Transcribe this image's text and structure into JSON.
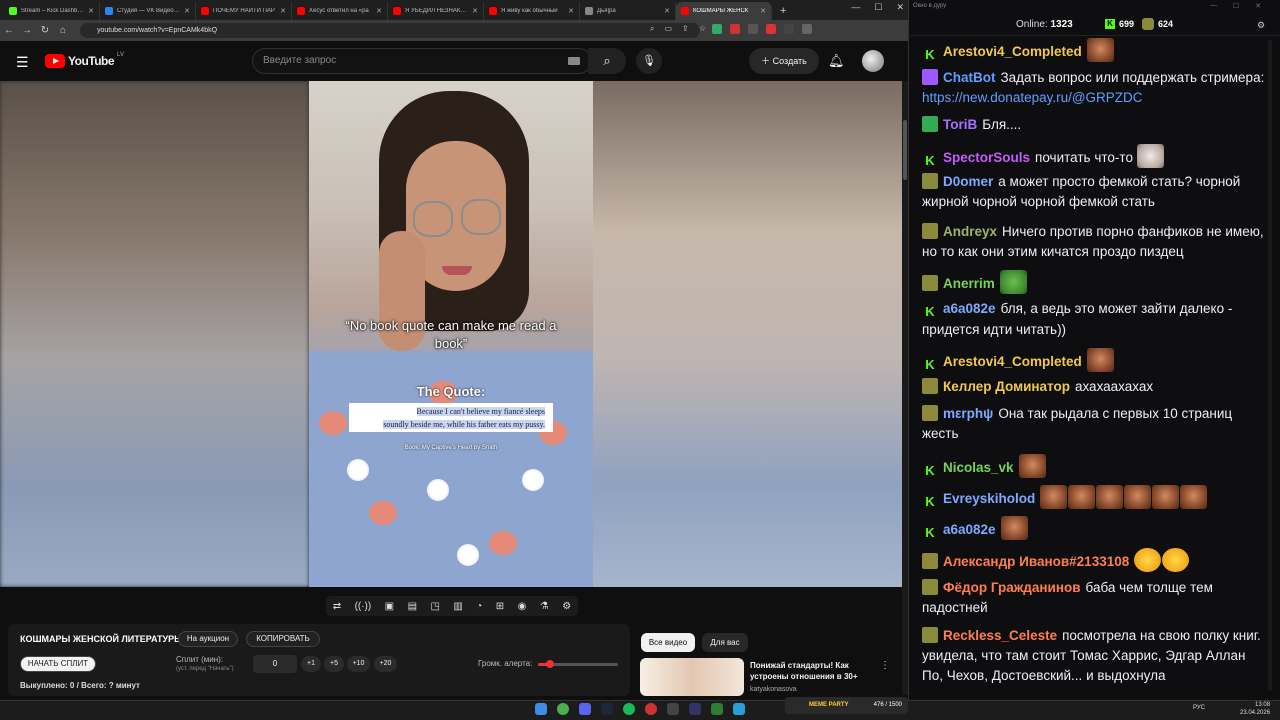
{
  "browser": {
    "tabs": [
      {
        "title": "Stream – Kick Dashboar",
        "color": "#53fc18"
      },
      {
        "title": "Студия — VK Видео (Ан",
        "color": "#2787f5"
      },
      {
        "title": "ПОЧЕМУ НАЙТИ ПАР",
        "color": "#ff0000"
      },
      {
        "title": "Хесус ответил на «ра",
        "color": "#ff0000"
      },
      {
        "title": "Я УБЕДИЛ НЕЗНАКОМ",
        "color": "#ff0000"
      },
      {
        "title": "Я живу как обычный",
        "color": "#ff0000"
      },
      {
        "title": "Дья|ра",
        "color": "#888888"
      },
      {
        "title": "КОШМАРЫ ЖЕНСК",
        "color": "#ff0000"
      }
    ],
    "url": "youtube.com/watch?v=EpnCAMk4bkQ"
  },
  "youtube": {
    "logo_text": "YouTube",
    "region": "LV",
    "search_placeholder": "Введите запрос",
    "create_label": "Создать"
  },
  "video": {
    "quote_caption": "“No book quote can make me read a book”",
    "quote_heading": "The Quote:",
    "quote_text_a": "Because I can't believe my fiancé sleeps",
    "quote_text_b": "soundly beside me, while his father eats my pussy.",
    "book_source": "Book: My Captive's Heart by Smith"
  },
  "auction": {
    "title": "КОШМАРЫ ЖЕНСКОЙ ЛИТЕРАТУРЫ",
    "auction_btn": "На аукцион",
    "copy_btn": "КОПИРОВАТЬ",
    "start_split_btn": "НАЧАТЬ СПЛИТ",
    "split_label": "Сплит (мин):",
    "split_hint": "(уст. перед \"Начать\")",
    "split_value": "0",
    "increments": [
      "+1",
      "+5",
      "+10",
      "+20"
    ],
    "volume_label": "Громк. алерта:",
    "volume_fraction": 0.15,
    "bought_label": "Выкуплено: 0 / Всего: ? минут"
  },
  "recommendations": {
    "tab_all": "Все видео",
    "tab_for_you": "Для вас",
    "item_title": "Понижай стандарты! Как устроены отношения в 30+",
    "item_channel": "katyakonasova"
  },
  "chat": {
    "window_title": "Окно в дуру",
    "online_label": "Online:",
    "online_count": "1323",
    "count_kick": "699",
    "count_other": "624",
    "messages": [
      {
        "badge": "kick",
        "user": "Arestovi4_Completed",
        "color": "#f2c94c",
        "text": "",
        "emotes": [
          "face"
        ]
      },
      {
        "badge": "purple",
        "user": "ChatBot",
        "color": "#5f9fff",
        "text": "Задать вопрос или поддержать стримера: ",
        "link": "https://new.donatepay.ru/@GRPZDC",
        "emotes": []
      },
      {
        "badge": "shield",
        "user": "ToriB",
        "color": "#a970ff",
        "text": "Бля....",
        "emotes": []
      },
      {
        "badge": "kick",
        "user": "SpectorSouls",
        "color": "#c45bff",
        "text": "почитать что-то",
        "emotes": [
          "cat"
        ]
      },
      {
        "badge": "green",
        "user": "D0omer",
        "color": "#7fa8ff",
        "text": "а может просто фемкой стать? чорной жирной чорной чорной фемкой стать",
        "emotes": []
      },
      {
        "badge": "green",
        "user": "Andreyx",
        "color": "#9fb36a",
        "text": "Ничего против порно фанфиков не имею, но то как они этим кичатся проздо пиздец",
        "emotes": []
      },
      {
        "badge": "green",
        "user": "Anerrim",
        "color": "#7bd15a",
        "text": "",
        "emotes": [
          "frog"
        ]
      },
      {
        "badge": "kick",
        "user": "a6a082e",
        "color": "#7fa8ff",
        "text": "бля, а ведь это может зайти далеко - придется идти читать))",
        "emotes": []
      },
      {
        "badge": "kick",
        "user": "Arestovi4_Completed",
        "color": "#f2c94c",
        "text": "",
        "emotes": [
          "face"
        ]
      },
      {
        "badge": "green",
        "user": "Келлер Доминатор",
        "color": "#f2c94c",
        "text": "ахахаахахах",
        "emotes": []
      },
      {
        "badge": "green",
        "user": "mεrphψ",
        "color": "#7fa8ff",
        "text": "Она так рыдала с первых 10 страниц жесть",
        "emotes": []
      },
      {
        "badge": "kick",
        "user": "Nicolas_vk",
        "color": "#7bd15a",
        "text": "",
        "emotes": [
          "face"
        ]
      },
      {
        "badge": "kick",
        "user": "Evreyskiholod",
        "color": "#7fa8ff",
        "text": "",
        "emotes": [
          "face",
          "face",
          "face",
          "face",
          "face",
          "face"
        ]
      },
      {
        "badge": "kick",
        "user": "a6a082e",
        "color": "#7fa8ff",
        "text": "",
        "emotes": [
          "face"
        ]
      },
      {
        "badge": "green",
        "user": "Александр Иванов#2133108",
        "color": "#ff7f50",
        "text": "",
        "emotes": [
          "laugh",
          "laugh"
        ]
      },
      {
        "badge": "green",
        "user": "Фёдор Гражданинов",
        "color": "#ff7f50",
        "text": "баба чем толще тем падостней",
        "emotes": []
      },
      {
        "badge": "green",
        "user": "Reckless_Celeste",
        "color": "#ff7f50",
        "text": "посмотрела на свою полку книг. увидела, что там стоит Томас Харрис, Эдгар Аллан По, Чехов, Достоевский... и выдохнула",
        "emotes": []
      }
    ]
  },
  "taskbar": {
    "meme_label": "MEME PARTY",
    "meme_progress": "476 / 1500",
    "lang": "РУС",
    "time": "13:08",
    "date": "23.04.2026"
  }
}
